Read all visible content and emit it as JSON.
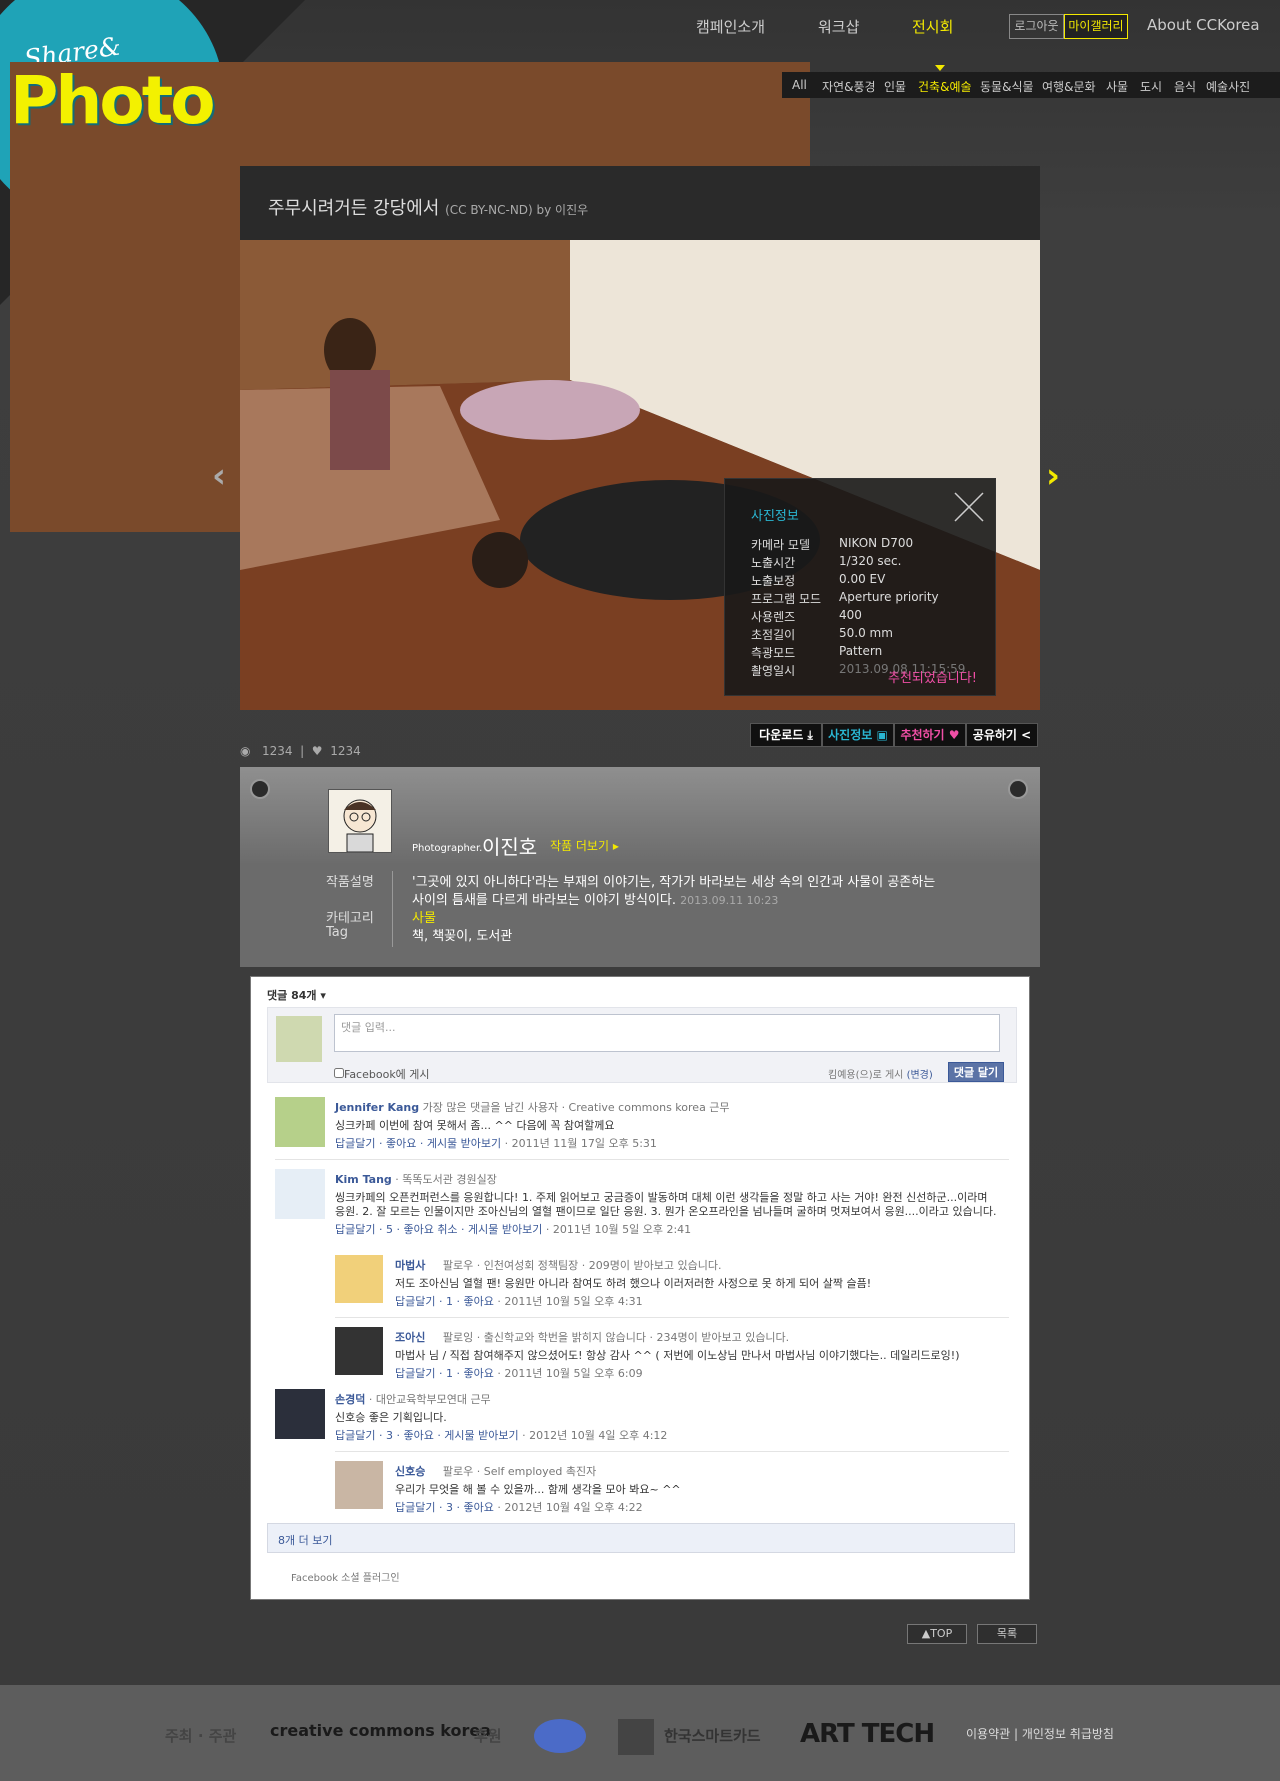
{
  "logo": {
    "line1": "Share&",
    "line2": "Photo"
  },
  "nav": {
    "items": [
      "캠페인소개",
      "워크샵",
      "전시회"
    ],
    "active": "전시회",
    "logout": "로그아웃",
    "mygallery": "마이갤러리",
    "about": "About CCKorea"
  },
  "categories": [
    "All",
    "자연&풍경",
    "인물",
    "건축&예술",
    "동물&식물",
    "여행&문화",
    "사물",
    "도시",
    "음식",
    "예술사진"
  ],
  "category_active": "건축&예술",
  "photo": {
    "title": "주무시려거든 강당에서",
    "license": "(CC BY-NC-ND) by 이진우"
  },
  "info": {
    "title": "사진정보",
    "rows": [
      [
        "카메라 모델",
        "NIKON D700"
      ],
      [
        "노출시간",
        "1/320 sec."
      ],
      [
        "노출보정",
        "0.00 EV"
      ],
      [
        "프로그램 모드",
        "Aperture priority"
      ],
      [
        "사용렌즈",
        "400"
      ],
      [
        "초점길이",
        "50.0 mm"
      ],
      [
        "측광모드",
        "Pattern"
      ],
      [
        "촬영일시",
        "2013.09.08 11:15:59"
      ]
    ],
    "recommended": "추천되었습니다!"
  },
  "tools": {
    "download": "다운로드",
    "info": "사진정보",
    "recommend": "추천하기",
    "share": "공유하기"
  },
  "stats": {
    "views": "1234",
    "likes": "1234"
  },
  "profile": {
    "role": "Photographer.",
    "name": "이진호",
    "more": "작품 더보기 ▸",
    "desc_label": "작품설명",
    "desc": "'그곳에 있지 아니하다'라는 부재의 이야기는, 작가가 바라보는 세상 속의 인간과 사물이 공존하는",
    "desc2": "사이의 틈새를 다르게 바라보는 이야기 방식이다.",
    "date": "2013.09.11 10:23",
    "category_label": "카테고리",
    "category": "사물",
    "tag_label": "Tag",
    "tags": "책, 책꽂이, 도서관"
  },
  "comments": {
    "header": "댓글 84개",
    "placeholder": "댓글 입력...",
    "fb_post": "Facebook에 게시",
    "post_as": "킴예용(으)로 게시",
    "change": "(변경)",
    "submit": "댓글 달기",
    "more": "8개 더 보기",
    "plugin": "Facebook 소셜 플러그인",
    "items": [
      {
        "name": "Jennifer Kang",
        "meta": "가장 많은 댓글을 남긴 사용자 · Creative commons korea 근무",
        "text": "싱크카페 이번에 참여 못해서 좀... ^^ 다음에 꼭 참여할께요",
        "actions": "답글달기 · 좋아요 · 게시물 받아보기",
        "time": " · 2011년 11월 17일 오후 5:31"
      },
      {
        "name": "Kim Tang",
        "meta": " · 똑똑도서관 경원실장",
        "text": "씽크카페의 오픈컨퍼런스를 응원합니다! 1. 주제 읽어보고 궁금증이 발동하며 대체 이런 생각들을 정말 하고 사는 거야! 완전 신선하군...이라며",
        "text2": "응원. 2. 잘 모르는 인물이지만 조아신님의 열혈 팬이므로 일단 응원. 3. 뭔가 온오프라인을 넘나들며 굴하며 멋져보여서 응원....이라고 있습니다.",
        "actions": "답글달기 · 5 · 좋아요 취소 · 게시물 받아보기",
        "time": " · 2011년 10월 5일 오후 2:41"
      },
      {
        "name": "마법사",
        "meta": "팔로우 · 인천여성회 정책팀장 · 209명이 받아보고 있습니다.",
        "text": "저도 조아신님 열혈 팬! 응원만 아니라 참여도 하려 했으나 이러저러한 사정으로 못 하게 되어 살짝 슬픔!",
        "actions": "답글달기 · 1 · 좋아요",
        "time": " · 2011년 10월 5일 오후 4:31"
      },
      {
        "name": "조아신",
        "meta": "팔로잉 · 출신학교와 학번을 밝히지 않습니다 · 234명이 받아보고 있습니다.",
        "text": "마법사 님 / 직접 참여해주지 않으셨어도! 항상 감사 ^^ ( 저번에 이노상님 만나서 마법사님 이야기했다는.. 데일리드로잉!)",
        "actions": "답글달기 · 1 · 좋아요",
        "time": " · 2011년 10월 5일 오후 6:09"
      },
      {
        "name": "손경덕",
        "meta": " · 대안교육학부모연대 근무",
        "text": "신호승 좋은 기획입니다.",
        "actions": "답글달기 · 3 · 좋아요 · 게시물 받아보기",
        "time": " · 2012년 10월 4일 오후 4:12"
      },
      {
        "name": "신호승",
        "meta": "팔로우 · Self employed 촉진자",
        "text": "우리가 무엇을 해 볼 수 있을까... 함께 생각을 모아 봐요~ ^^",
        "actions": "답글달기 · 3 · 좋아요",
        "time": " · 2012년 10월 4일 오후 4:22"
      }
    ]
  },
  "bottom": {
    "top": "▲TOP",
    "list": "목록"
  },
  "footer": {
    "host": "주최 · 주관",
    "cc": "creative commons korea",
    "sponsor": "후원",
    "tmoney": "한국스마트카드",
    "arttech": "ART TECH",
    "links": "이용약관 | 개인정보 취급방침"
  }
}
